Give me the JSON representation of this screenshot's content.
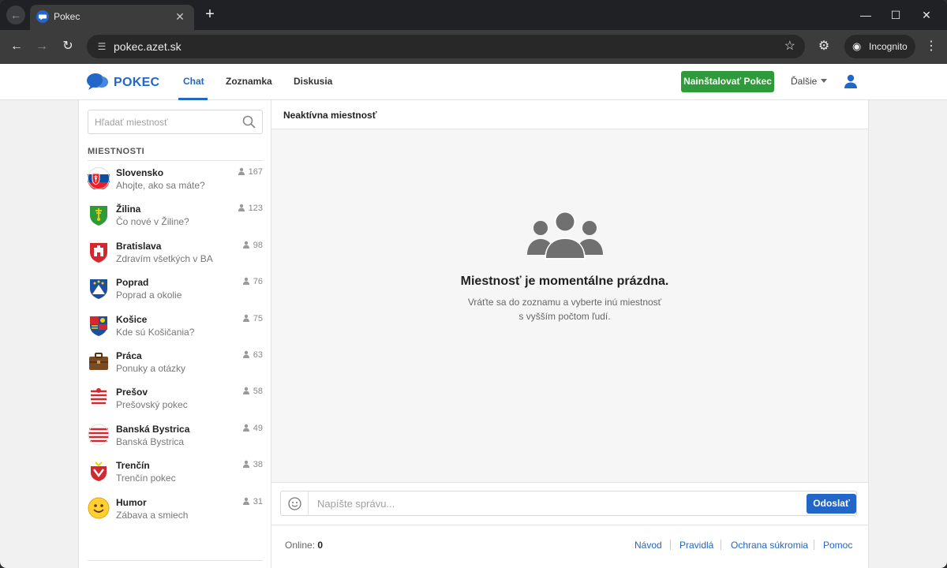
{
  "browser": {
    "tab_title": "Pokec",
    "url": "pokec.azet.sk",
    "incognito_label": "Incognito",
    "icons": {
      "back_mini": "back-arrow-icon",
      "tab_close": "close-icon",
      "new_tab": "plus-icon",
      "back": "arrow-left-icon",
      "forward": "arrow-right-icon",
      "reload": "reload-icon",
      "site_info": "tune-icon",
      "bookmark": "star-icon",
      "extensions": "extensions-icon",
      "menu": "kebab-menu-icon"
    }
  },
  "app": {
    "brand": "POKEC",
    "brand_color": "#2266c8",
    "nav": {
      "chat": "Chat",
      "zoznamka": "Zoznamka",
      "diskusia": "Diskusia"
    },
    "install_label": "Nainštalovať Pokec",
    "install_color": "#2e9a3a",
    "more_label": "Ďalšie"
  },
  "sidebar": {
    "search_placeholder": "Hľadať miestnosť",
    "section_title": "MIESTNOSTI",
    "rooms": [
      {
        "name": "Slovensko",
        "subtitle": "Ahojte, ako sa máte?",
        "count": "167",
        "icon": "slovakia-flag-icon"
      },
      {
        "name": "Žilina",
        "subtitle": "Čo nové v Žiline?",
        "count": "123",
        "icon": "zilina-coat-of-arms-icon"
      },
      {
        "name": "Bratislava",
        "subtitle": "Zdravím všetkých v BA",
        "count": "98",
        "icon": "bratislava-coat-of-arms-icon"
      },
      {
        "name": "Poprad",
        "subtitle": "Poprad a okolie",
        "count": "76",
        "icon": "poprad-coat-of-arms-icon"
      },
      {
        "name": "Košice",
        "subtitle": "Kde sú Košičania?",
        "count": "75",
        "icon": "kosice-coat-of-arms-icon"
      },
      {
        "name": "Práca",
        "subtitle": "Ponuky a otázky",
        "count": "63",
        "icon": "briefcase-icon"
      },
      {
        "name": "Prešov",
        "subtitle": "Prešovský pokec",
        "count": "58",
        "icon": "presov-coat-of-arms-icon"
      },
      {
        "name": "Banská Bystrica",
        "subtitle": "Banská Bystrica",
        "count": "49",
        "icon": "banska-bystrica-coat-of-arms-icon"
      },
      {
        "name": "Trenčín",
        "subtitle": "Trenčín pokec",
        "count": "38",
        "icon": "trencin-coat-of-arms-icon"
      },
      {
        "name": "Humor",
        "subtitle": "Zábava a smiech",
        "count": "31",
        "icon": "smiley-icon"
      }
    ]
  },
  "main": {
    "room_title": "Neaktívna miestnosť",
    "empty_title": "Miestnosť je momentálne prázdna.",
    "empty_line1": "Vráťte sa do zoznamu a vyberte inú miestnosť",
    "empty_line2": "s vyšším počtom ľudí.",
    "message_placeholder": "Napíšte správu...",
    "send_label": "Odoslať",
    "send_color": "#2266c8",
    "online_label": "Online:",
    "online_count": "0",
    "footer_links": {
      "navod": "Návod",
      "pravidla": "Pravidlá",
      "privacy": "Ochrana súkromia",
      "help": "Pomoc"
    }
  }
}
